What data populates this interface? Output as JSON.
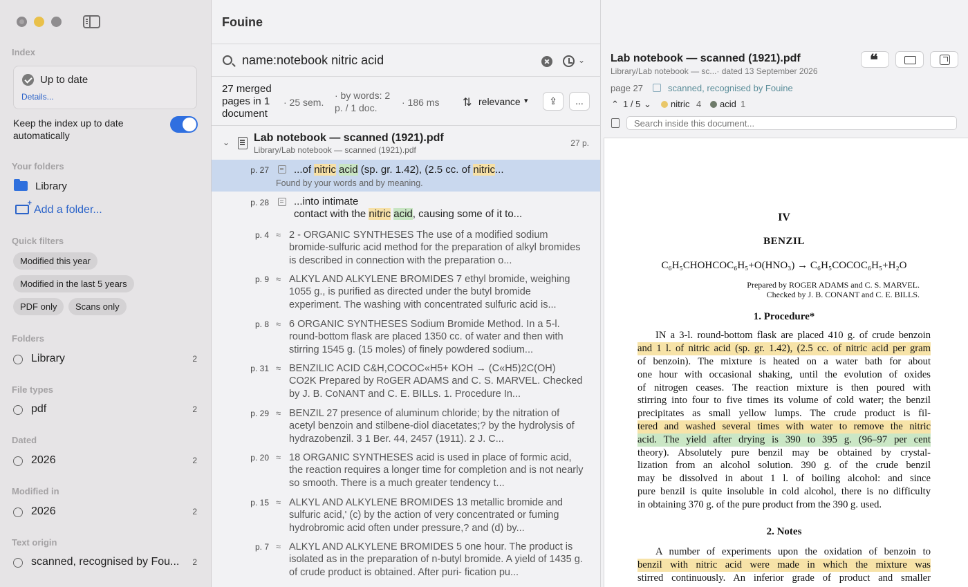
{
  "sidebar": {
    "index_label": "Index",
    "index_status": "Up to date",
    "details_link": "Details...",
    "keep_updated_label": "Keep the index up to date automatically",
    "keep_updated_on": true,
    "your_folders_label": "Your folders",
    "folder_name": "Library",
    "add_folder_label": "Add a folder...",
    "quick_filters_label": "Quick filters",
    "quick_filters": [
      "Modified this year",
      "Modified in the last 5 years",
      "PDF only",
      "Scans only"
    ],
    "facets": [
      {
        "label": "Folders",
        "name": "Library",
        "count": "2"
      },
      {
        "label": "File types",
        "name": "pdf",
        "count": "2"
      },
      {
        "label": "Dated",
        "name": "2026",
        "count": "2"
      },
      {
        "label": "Modified in",
        "name": "2026",
        "count": "2"
      },
      {
        "label": "Text origin",
        "name": "scanned, recognised by Fou...",
        "count": "2"
      }
    ]
  },
  "app_title": "Fouine",
  "search": {
    "query": "name:notebook nitric acid"
  },
  "stats": {
    "merged": "27 merged pages in 1 document",
    "semantic": "· 25 sem.",
    "by_words": "· by words: 2 p. / 1 doc.",
    "time": "· 186 ms",
    "sort": "relevance",
    "more": "..."
  },
  "doc": {
    "title": "Lab notebook — scanned (1921).pdf",
    "path": "Library/Lab notebook — scanned (1921).pdf",
    "pages": "27 p."
  },
  "results": {
    "r1": {
      "page": "p. 27",
      "t1": "...of ",
      "t2": "nitric",
      "t3": " ",
      "t4": "acid",
      "t5": " (sp. gr. 1.42), (2.5 cc. of ",
      "t6": "nitric",
      "t7": "...",
      "sub": "Found by your words and by meaning."
    },
    "r2": {
      "page": "p. 28",
      "line1": "...into intimate",
      "t1": "contact with the ",
      "t2": "nitric",
      "t3": " ",
      "t4": "acid",
      "t5": ", causing some of it to..."
    },
    "semantic_glyph": "≈",
    "items": [
      {
        "page": "p. 4",
        "text": "2 - ORGANIC SYNTHESES The use of a modified sodium bromide-sulfuric acid method for the preparation of alkyl bromides is described in connection with the preparation o..."
      },
      {
        "page": "p. 9",
        "text": "ALKYL AND ALKYLENE BROMIDES 7 ethyl bromide, weighing 1055 g., is purified as directed under the butyl bromide experiment. The washing with concentrated sulfuric acid is..."
      },
      {
        "page": "p. 8",
        "text": "6 ORGANIC SYNTHESES Sodium Bromide Method. In a 5-l. round-bottom flask are placed 1350 cc. of water and then with stirring 1545 g. (15 moles) of finely powdered sodium..."
      },
      {
        "page": "p. 31",
        "text": "BENZILIC ACID C&H,COCOC«H5+ KOH → (C«H5)2C(OH) CO2K Prepared by RoGER ADAMS and C. S. MARVEL. Checked by J. B. CoNANT and C. E. BILLs. 1. Procedure In..."
      },
      {
        "page": "p. 29",
        "text": "BENZIL 27 presence of aluminum chloride; by the nitration of acetyl benzoin and stilbene-diol diacetates;? by the hydrolysis of hydrazobenzil. 3 1 Ber. 44, 2457 (1911). 2 J. C..."
      },
      {
        "page": "p. 20",
        "text": "18 ORGANIC SYNTHESES acid is used in place of formic acid, the reaction requires a longer time for completion and is not nearly so smooth. There is a much greater tendency t..."
      },
      {
        "page": "p. 15",
        "text": "ALKYL AND ALKYLENE BROMIDES 13 metallic bromide and sulfuric acid,' (c) by the action of very concentrated or fuming hydrobromic acid often under pressure,? and (d) by..."
      },
      {
        "page": "p. 7",
        "text": "ALKYL AND ALKYLENE BROMIDES 5 one hour. The product is isolated as in the preparation of n-butyl bromide. A yield of 1435 g. of crude product is obtained. After puri- fication pu..."
      }
    ]
  },
  "preview": {
    "title": "Lab notebook — scanned (1921).pdf",
    "subtitle": "Library/Lab notebook — sc...· dated 13 September 2026",
    "page": "page 27",
    "origin": "scanned, recognised by Fouine",
    "nav": "1 / 5",
    "terms": [
      {
        "word": "nitric",
        "count": "4",
        "color": "#e9c769"
      },
      {
        "word": "acid",
        "count": "1",
        "color": "#6e7b6a"
      }
    ],
    "find_placeholder": "Search inside this document..."
  },
  "paper": {
    "chapter": "IV",
    "title": "BENZIL",
    "equation": "C₆H₅CHOHCOC₆H₅+O(HNO₃) → C₆H₅COCOC₆H₅+H₂O",
    "credit1": "Prepared by ROGER ADAMS and C. S. MARVEL.",
    "credit2": "Checked by J. B. CONANT and C. E. BILLS.",
    "heading1": "1. Procedure*",
    "lines": [
      "IN a 3-l. round-bottom flask are placed 410 g. of crude benzoin",
      "and 1 l. of nitric acid (sp. gr. 1.42), (2.5 cc. of nitric acid per gram",
      "of benzoin). The mixture is heated on a water bath for about",
      "one hour with occasional shaking, until the evolution of oxides",
      "of nitrogen ceases. The reaction mixture is then poured with",
      "stirring into four to five times its volume of cold water; the benzil",
      "precipitates as small yellow lumps. The crude product is fil-",
      "tered and washed several times with water to remove the nitric",
      "acid. The yield after drying is 390 to 395 g. (96–97 per cent",
      "theory). Absolutely pure benzil may be obtained by crystal-",
      "lization from an alcohol solution. 390 g. of the crude benzil",
      "may be dissolved in about 1 l. of boiling alcohol: and since",
      "pure benzil is quite insoluble in cold alcohol, there is no difficulty",
      "in obtaining 370 g. of the pure product from the 390 g. used."
    ],
    "heading2": "2. Notes",
    "notes": [
      "A number of experiments upon the oxidation of benzoin to",
      "benzil with nitric acid were made in which the mixture was",
      "stirred continuously. An inferior grade of product and smaller"
    ]
  },
  "colors": {
    "accent": "#2f6fe0",
    "selection": "#c9d8ee",
    "highlight_word": "#f6e0a6",
    "highlight_meaning": "#c8e5c3"
  }
}
